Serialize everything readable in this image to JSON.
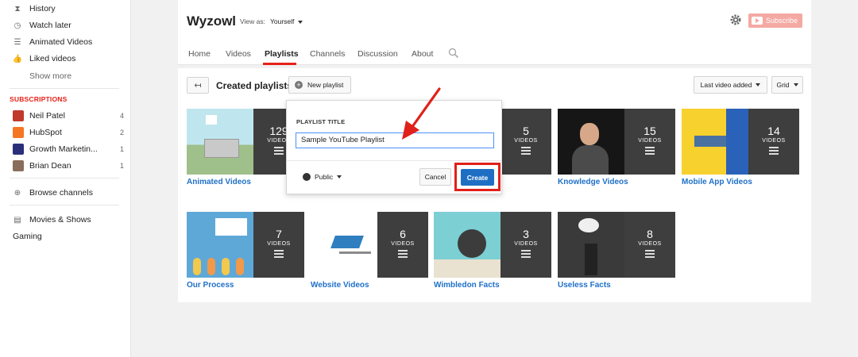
{
  "sidebar": {
    "items": [
      {
        "label": "History",
        "icon": "hourglass-icon"
      },
      {
        "label": "Watch later",
        "icon": "clock-icon"
      },
      {
        "label": "Animated Videos",
        "icon": "list-icon"
      },
      {
        "label": "Liked videos",
        "icon": "thumbs-up-icon"
      }
    ],
    "show_more": "Show more",
    "subscriptions_heading": "SUBSCRIPTIONS",
    "subscriptions": [
      {
        "label": "Neil Patel",
        "count": "4",
        "color": "#c0392b"
      },
      {
        "label": "HubSpot",
        "count": "2",
        "color": "#f57722"
      },
      {
        "label": "Growth Marketin...",
        "count": "1",
        "color": "#2b2f7a"
      },
      {
        "label": "Brian Dean",
        "count": "1",
        "color": "#8a6d5a"
      }
    ],
    "browse_channels": "Browse channels",
    "movies_shows": "Movies & Shows",
    "gaming": "Gaming"
  },
  "header": {
    "channel_name": "Wyzowl",
    "view_as_label": "View as:",
    "view_as_value": "Yourself",
    "subscribe_label": "Subscribe",
    "tabs": [
      "Home",
      "Videos",
      "Playlists",
      "Channels",
      "Discussion",
      "About"
    ],
    "active_tab": "Playlists"
  },
  "toolbar": {
    "section_title": "Created playlists",
    "new_playlist_label": "New playlist",
    "sort_label": "Last video added",
    "view_label": "Grid"
  },
  "modal": {
    "field_label": "PLAYLIST TITLE",
    "field_value": "Sample YouTube Playlist",
    "privacy_label": "Public",
    "cancel_label": "Cancel",
    "create_label": "Create"
  },
  "playlists": [
    {
      "title": "Animated Videos",
      "count": "129",
      "videos_label": "VIDEOS"
    },
    {
      "title": "",
      "count": "5",
      "videos_label": "VIDEOS"
    },
    {
      "title": "Knowledge Videos",
      "count": "15",
      "videos_label": "VIDEOS"
    },
    {
      "title": "Mobile App Videos",
      "count": "14",
      "videos_label": "VIDEOS"
    },
    {
      "title": "Our Process",
      "count": "7",
      "videos_label": "VIDEOS"
    },
    {
      "title": "Website Videos",
      "count": "6",
      "videos_label": "VIDEOS"
    },
    {
      "title": "Wimbledon Facts",
      "count": "3",
      "videos_label": "VIDEOS"
    },
    {
      "title": "Useless Facts",
      "count": "8",
      "videos_label": "VIDEOS"
    }
  ],
  "colors": {
    "accent_red": "#e62117",
    "link_blue": "#1f70c7",
    "create_blue": "#1e6fc4",
    "highlight_red": "#e0201a"
  }
}
